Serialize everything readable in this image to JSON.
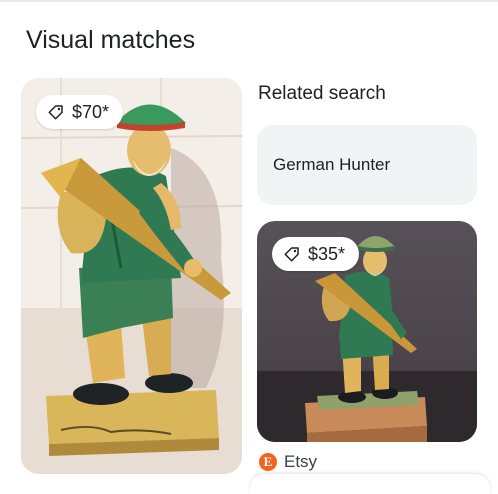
{
  "page": {
    "heading": "Visual matches"
  },
  "results": [
    {
      "price": "$70*",
      "image_alt": "Carved wooden hunter figurine with green hat and rifle"
    },
    {
      "price": "$35*",
      "image_alt": "Carved wooden hunter figurine on a wooden base",
      "source": "Etsy"
    }
  ],
  "related": {
    "title": "Related search",
    "query": "German Hunter"
  },
  "icons": {
    "price": "price-tag-icon",
    "etsy": "etsy-logo-icon"
  },
  "colors": {
    "chip_bg": "#f1f3f4",
    "etsy": "#f1641e",
    "text": "#202124"
  }
}
